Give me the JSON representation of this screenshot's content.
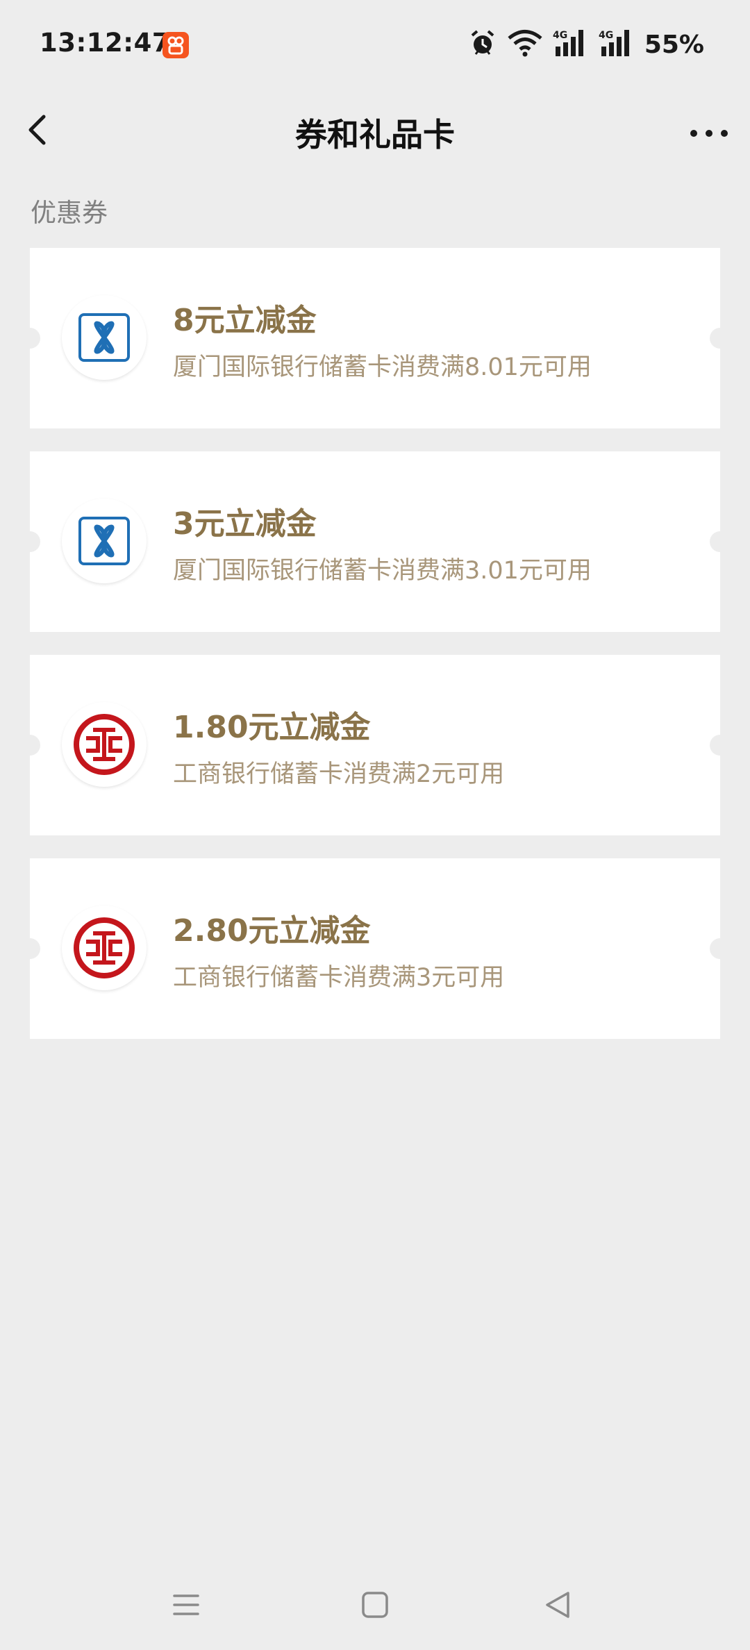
{
  "status_bar": {
    "time": "13:12:47",
    "app_icon": "kuaishou-app-icon",
    "icons": [
      "alarm-icon",
      "wifi-icon",
      "signal-4g-icon",
      "signal-4g-icon"
    ],
    "battery": "55%"
  },
  "nav": {
    "title": "券和礼品卡",
    "back_icon": "back-chevron-icon",
    "more_icon": "more-dots-icon"
  },
  "section": {
    "label": "优惠券"
  },
  "coupons": [
    {
      "title": "8元立减金",
      "description": "厦门国际银行储蓄卡消费满8.01元可用",
      "bank_logo": "xiamen-international-bank-logo"
    },
    {
      "title": "3元立减金",
      "description": "厦门国际银行储蓄卡消费满3.01元可用",
      "bank_logo": "xiamen-international-bank-logo"
    },
    {
      "title": "1.80元立减金",
      "description": "工商银行储蓄卡消费满2元可用",
      "bank_logo": "icbc-logo"
    },
    {
      "title": "2.80元立减金",
      "description": "工商银行储蓄卡消费满3元可用",
      "bank_logo": "icbc-logo"
    }
  ],
  "colors": {
    "background": "#ededed",
    "card": "#ffffff",
    "coupon_title": "#8a7349",
    "coupon_desc": "#a8967a",
    "xiamen_blue": "#1f6fb5",
    "icbc_red": "#c4161c"
  },
  "system_nav": {
    "icons": [
      "menu-icon",
      "home-icon",
      "back-triangle-icon"
    ]
  }
}
